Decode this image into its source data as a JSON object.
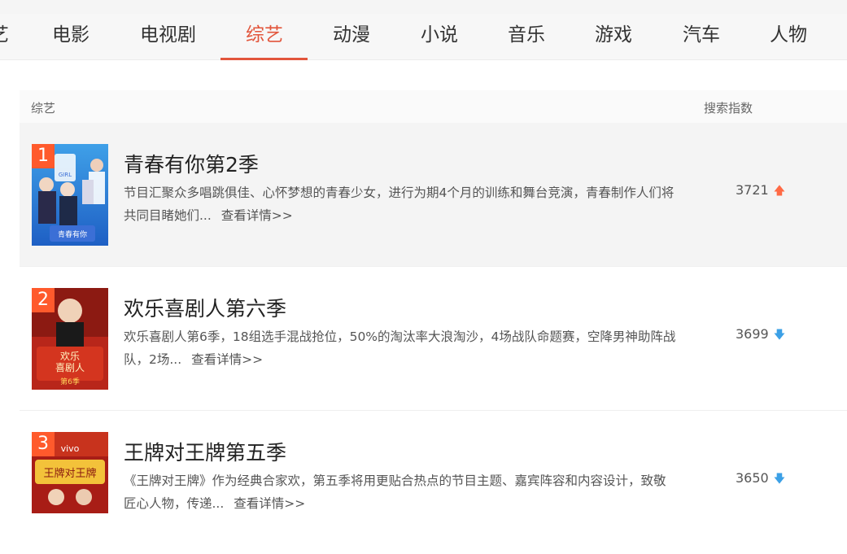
{
  "tabs": {
    "partial": "艺",
    "items": [
      "电影",
      "电视剧",
      "综艺",
      "动漫",
      "小说",
      "音乐",
      "游戏",
      "汽车",
      "人物"
    ],
    "active": "综艺"
  },
  "panel": {
    "category": "综艺",
    "index_header": "搜索指数"
  },
  "more_label": "查看详情>>",
  "rows": [
    {
      "rank": "1",
      "title": "青春有你第2季",
      "desc": "节目汇聚众多唱跳俱佳、心怀梦想的青春少女，进行为期4个月的训练和舞台竞演，青春制作人们将共同目睹她们...",
      "score": "3721",
      "trend": "up",
      "poster_text": [
        "GIRL",
        "青春有你"
      ]
    },
    {
      "rank": "2",
      "title": "欢乐喜剧人第六季",
      "desc": "欢乐喜剧人第6季，18组选手混战抢位，50%的淘汰率大浪淘沙，4场战队命题赛，空降男神助阵战队，2场...",
      "score": "3699",
      "trend": "down",
      "poster_text": [
        "欢乐",
        "喜剧人",
        "第6季"
      ]
    },
    {
      "rank": "3",
      "title": "王牌对王牌第五季",
      "desc": "《王牌对王牌》作为经典合家欢，第五季将用更贴合热点的节目主题、嘉宾阵容和内容设计，致敬匠心人物，传递...",
      "score": "3650",
      "trend": "down",
      "poster_text": [
        "vivo",
        "王牌对王牌"
      ]
    }
  ],
  "colors": {
    "accent": "#e2553b",
    "rank_badge": "#ff5a2c",
    "trend_up": "#ff6a45",
    "trend_down": "#3ca0e6"
  }
}
